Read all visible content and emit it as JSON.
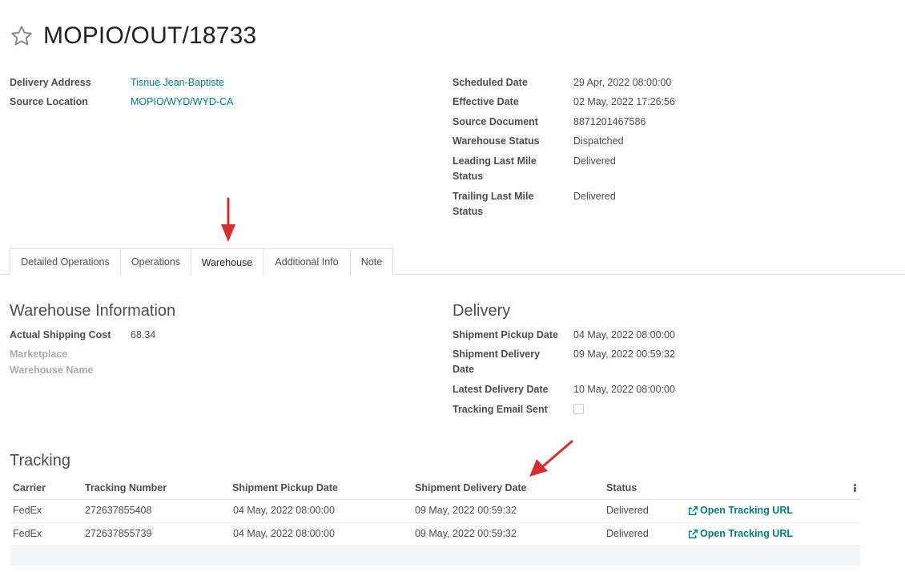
{
  "record": {
    "title": "MOPIO/OUT/18733"
  },
  "header_left": [
    {
      "label": "Delivery Address",
      "value": "Tisnue Jean-Baptiste"
    },
    {
      "label": "Source Location",
      "value": "MOPIO/WYD/WYD-CA"
    }
  ],
  "header_right": {
    "scheduled_date": {
      "label": "Scheduled Date",
      "value": "29 Apr, 2022 08:00:00"
    },
    "effective_date": {
      "label": "Effective Date",
      "value": "02 May, 2022 17:26:56"
    },
    "source_document": {
      "label": "Source Document",
      "value": "8871201467586"
    },
    "warehouse_status": {
      "label": "Warehouse Status",
      "value": "Dispatched"
    },
    "leading_last_mile": {
      "label_line1": "Leading Last Mile",
      "label_line2": "Status",
      "value": "Delivered"
    },
    "trailing_last_mile": {
      "label_line1": "Trailing Last Mile",
      "label_line2": "Status",
      "value": "Delivered"
    }
  },
  "tabs": [
    {
      "label": "Detailed Operations"
    },
    {
      "label": "Operations"
    },
    {
      "label": "Warehouse",
      "active": true
    },
    {
      "label": "Additional Info"
    },
    {
      "label": "Note"
    }
  ],
  "warehouse_info": {
    "title": "Warehouse Information",
    "actual_shipping_cost": {
      "label": "Actual Shipping Cost",
      "value": "68.34"
    },
    "marketplace": {
      "label": "Marketplace",
      "value": ""
    },
    "warehouse_name": {
      "label": "Warehouse Name",
      "value": ""
    }
  },
  "delivery": {
    "title": "Delivery",
    "shipment_pickup_date": {
      "label": "Shipment Pickup Date",
      "value": "04 May, 2022 08:00:00"
    },
    "shipment_delivery_date": {
      "label_line1": "Shipment Delivery",
      "label_line2": "Date",
      "value": "09 May, 2022 00:59:32"
    },
    "latest_delivery_date": {
      "label": "Latest Delivery Date",
      "value": "10 May, 2022 08:00:00"
    },
    "tracking_email_sent": {
      "label": "Tracking Email Sent",
      "checked": false
    }
  },
  "tracking": {
    "title": "Tracking",
    "columns": [
      "Carrier",
      "Tracking Number",
      "Shipment Pickup Date",
      "Shipment Delivery Date",
      "Status"
    ],
    "rows": [
      {
        "carrier": "FedEx",
        "tracking_number": "272637855408",
        "pickup": "04 May, 2022 08:00:00",
        "delivery": "09 May, 2022 00:59:32",
        "status": "Delivered",
        "link": "Open Tracking URL"
      },
      {
        "carrier": "FedEx",
        "tracking_number": "272637855739",
        "pickup": "04 May, 2022 08:00:00",
        "delivery": "09 May, 2022 00:59:32",
        "status": "Delivered",
        "link": "Open Tracking URL"
      }
    ]
  },
  "colors": {
    "accent": "#017e84",
    "annotation_arrow": "#d32f2f",
    "text": "#4c4c4c"
  },
  "icons": {
    "favorite": "star-outline-icon",
    "external_link": "external-link-icon",
    "column_options": "kebab-icon"
  }
}
